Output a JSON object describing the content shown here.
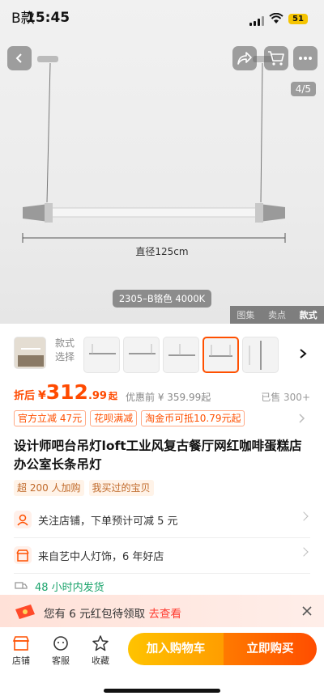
{
  "status_bar": {
    "overlay_text": "B款",
    "time": "15:45",
    "battery": "51"
  },
  "hero": {
    "pager": "4/5",
    "dimension_label": "直径125cm",
    "variant_pill": "2305–B铬色 4000K",
    "view_tabs": [
      "图集",
      "卖点",
      "款式"
    ],
    "active_view_tab": "款式"
  },
  "variant_selector": {
    "label_line1": "款式",
    "label_line2": "选择",
    "thumb_count": 5,
    "selected_index": 4
  },
  "price": {
    "prefix": "折后",
    "currency": "¥",
    "integer": "312",
    "decimals": ".99",
    "suffix": "起",
    "pre_discount": "优惠前 ¥ 359.99起",
    "sold": "已售 300+"
  },
  "coupons": [
    "官方立减 47元",
    "花呗满减",
    "淘金币可抵10.79元起"
  ],
  "product_title": "设计师吧台吊灯loft工业风复古餐厅网红咖啡蛋糕店办公室长条吊灯",
  "tags": [
    "超 200 人加购",
    "我买过的宝贝"
  ],
  "info_rows": [
    {
      "text": "关注店铺，下单预计可减 5 元",
      "icon": "store-follow-icon"
    },
    {
      "text": "来自艺中人灯饰，6 年好店",
      "icon": "shop-icon"
    },
    {
      "text": "48 小时内发货",
      "icon": "truck-icon"
    }
  ],
  "banner": {
    "text_pre": "您有 6 元红包待领取",
    "link": "去查看"
  },
  "bottom_bar": {
    "store": "店铺",
    "service": "客服",
    "favorite": "收藏",
    "add_to_cart": "加入购物车",
    "buy_now": "立即购买"
  },
  "colors": {
    "accent": "#ff5000",
    "cart_yellow": "#ffb300"
  }
}
